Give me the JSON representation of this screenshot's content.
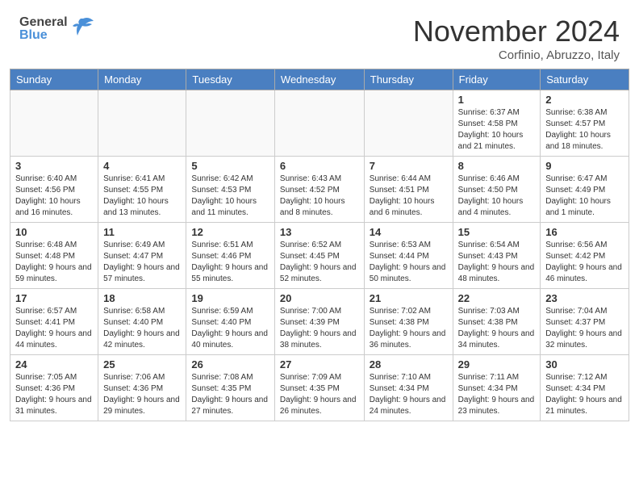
{
  "header": {
    "title": "November 2024",
    "location": "Corfinio, Abruzzo, Italy",
    "logo_general": "General",
    "logo_blue": "Blue"
  },
  "days_of_week": [
    "Sunday",
    "Monday",
    "Tuesday",
    "Wednesday",
    "Thursday",
    "Friday",
    "Saturday"
  ],
  "weeks": [
    [
      {
        "day": "",
        "empty": true
      },
      {
        "day": "",
        "empty": true
      },
      {
        "day": "",
        "empty": true
      },
      {
        "day": "",
        "empty": true
      },
      {
        "day": "",
        "empty": true
      },
      {
        "day": "1",
        "info": "Sunrise: 6:37 AM\nSunset: 4:58 PM\nDaylight: 10 hours and 21 minutes."
      },
      {
        "day": "2",
        "info": "Sunrise: 6:38 AM\nSunset: 4:57 PM\nDaylight: 10 hours and 18 minutes."
      }
    ],
    [
      {
        "day": "3",
        "info": "Sunrise: 6:40 AM\nSunset: 4:56 PM\nDaylight: 10 hours and 16 minutes."
      },
      {
        "day": "4",
        "info": "Sunrise: 6:41 AM\nSunset: 4:55 PM\nDaylight: 10 hours and 13 minutes."
      },
      {
        "day": "5",
        "info": "Sunrise: 6:42 AM\nSunset: 4:53 PM\nDaylight: 10 hours and 11 minutes."
      },
      {
        "day": "6",
        "info": "Sunrise: 6:43 AM\nSunset: 4:52 PM\nDaylight: 10 hours and 8 minutes."
      },
      {
        "day": "7",
        "info": "Sunrise: 6:44 AM\nSunset: 4:51 PM\nDaylight: 10 hours and 6 minutes."
      },
      {
        "day": "8",
        "info": "Sunrise: 6:46 AM\nSunset: 4:50 PM\nDaylight: 10 hours and 4 minutes."
      },
      {
        "day": "9",
        "info": "Sunrise: 6:47 AM\nSunset: 4:49 PM\nDaylight: 10 hours and 1 minute."
      }
    ],
    [
      {
        "day": "10",
        "info": "Sunrise: 6:48 AM\nSunset: 4:48 PM\nDaylight: 9 hours and 59 minutes."
      },
      {
        "day": "11",
        "info": "Sunrise: 6:49 AM\nSunset: 4:47 PM\nDaylight: 9 hours and 57 minutes."
      },
      {
        "day": "12",
        "info": "Sunrise: 6:51 AM\nSunset: 4:46 PM\nDaylight: 9 hours and 55 minutes."
      },
      {
        "day": "13",
        "info": "Sunrise: 6:52 AM\nSunset: 4:45 PM\nDaylight: 9 hours and 52 minutes."
      },
      {
        "day": "14",
        "info": "Sunrise: 6:53 AM\nSunset: 4:44 PM\nDaylight: 9 hours and 50 minutes."
      },
      {
        "day": "15",
        "info": "Sunrise: 6:54 AM\nSunset: 4:43 PM\nDaylight: 9 hours and 48 minutes."
      },
      {
        "day": "16",
        "info": "Sunrise: 6:56 AM\nSunset: 4:42 PM\nDaylight: 9 hours and 46 minutes."
      }
    ],
    [
      {
        "day": "17",
        "info": "Sunrise: 6:57 AM\nSunset: 4:41 PM\nDaylight: 9 hours and 44 minutes."
      },
      {
        "day": "18",
        "info": "Sunrise: 6:58 AM\nSunset: 4:40 PM\nDaylight: 9 hours and 42 minutes."
      },
      {
        "day": "19",
        "info": "Sunrise: 6:59 AM\nSunset: 4:40 PM\nDaylight: 9 hours and 40 minutes."
      },
      {
        "day": "20",
        "info": "Sunrise: 7:00 AM\nSunset: 4:39 PM\nDaylight: 9 hours and 38 minutes."
      },
      {
        "day": "21",
        "info": "Sunrise: 7:02 AM\nSunset: 4:38 PM\nDaylight: 9 hours and 36 minutes."
      },
      {
        "day": "22",
        "info": "Sunrise: 7:03 AM\nSunset: 4:38 PM\nDaylight: 9 hours and 34 minutes."
      },
      {
        "day": "23",
        "info": "Sunrise: 7:04 AM\nSunset: 4:37 PM\nDaylight: 9 hours and 32 minutes."
      }
    ],
    [
      {
        "day": "24",
        "info": "Sunrise: 7:05 AM\nSunset: 4:36 PM\nDaylight: 9 hours and 31 minutes."
      },
      {
        "day": "25",
        "info": "Sunrise: 7:06 AM\nSunset: 4:36 PM\nDaylight: 9 hours and 29 minutes."
      },
      {
        "day": "26",
        "info": "Sunrise: 7:08 AM\nSunset: 4:35 PM\nDaylight: 9 hours and 27 minutes."
      },
      {
        "day": "27",
        "info": "Sunrise: 7:09 AM\nSunset: 4:35 PM\nDaylight: 9 hours and 26 minutes."
      },
      {
        "day": "28",
        "info": "Sunrise: 7:10 AM\nSunset: 4:34 PM\nDaylight: 9 hours and 24 minutes."
      },
      {
        "day": "29",
        "info": "Sunrise: 7:11 AM\nSunset: 4:34 PM\nDaylight: 9 hours and 23 minutes."
      },
      {
        "day": "30",
        "info": "Sunrise: 7:12 AM\nSunset: 4:34 PM\nDaylight: 9 hours and 21 minutes."
      }
    ]
  ]
}
